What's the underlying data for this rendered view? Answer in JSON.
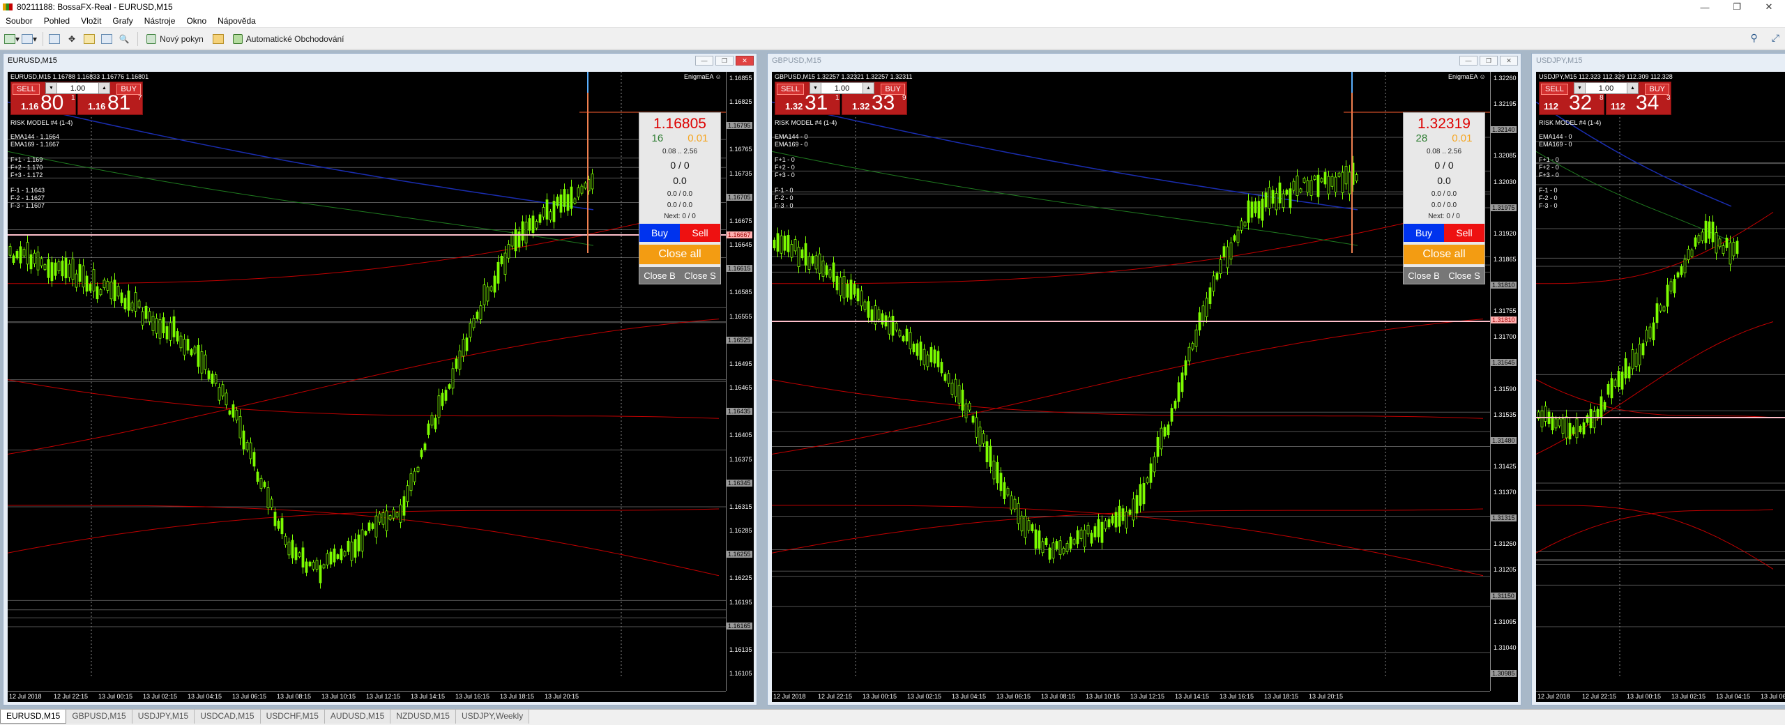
{
  "window": {
    "title": "80211188: BossaFX-Real - EURUSD,M15",
    "min_glyph": "—",
    "max_glyph": "❐",
    "close_glyph": "✕"
  },
  "menu": [
    "Soubor",
    "Pohled",
    "Vložit",
    "Grafy",
    "Nástroje",
    "Okno",
    "Nápověda"
  ],
  "toolbar": {
    "new_order_label": "Nový pokyn",
    "auto_trading_label": "Automatické Obchodování",
    "search_glyph": "⚲",
    "expand_glyph": "⤢"
  },
  "charts": [
    {
      "title": "EURUSD,M15",
      "symbol_line": "EURUSD,M15  1.16788 1.16833 1.16776 1.16801",
      "ea_name": "EnigmaEA ☺",
      "sell_label": "SELL",
      "buy_label": "BUY",
      "lot": "1.00",
      "sell_price": {
        "small": "1.16",
        "big": "80",
        "sup": "1"
      },
      "buy_price": {
        "small": "1.16",
        "big": "81",
        "sup": "7"
      },
      "risk_model": "RISK MODEL #4 (1-4)",
      "info_lines": "EMA144 - 1.1664\nEMA169 - 1.1667\n\nF+1 - 1.169\nF+2 - 1.170\nF+3 - 1.172\n\nF-1 - 1.1643\nF-2 - 1.1627\nF-3 - 1.1607",
      "panel": {
        "price": "1.16805",
        "spread": "16",
        "pip": "0.01",
        "range": "0.08 .. 2.56",
        "ratio": "0 / 0",
        "value": "0.0",
        "triple": "0.0 / 0.0",
        "pair": "0.0 / 0.0",
        "next": "Next: 0 / 0",
        "buy": "Buy",
        "sell": "Sell",
        "close_all": "Close all",
        "close_b": "Close B",
        "close_s": "Close S"
      },
      "prices": [
        "1.16855",
        "1.16825",
        "1.16795",
        "1.16765",
        "1.16735",
        "1.16705",
        "1.16675",
        "1.16645",
        "1.16615",
        "1.16585",
        "1.16555",
        "1.16525",
        "1.16495",
        "1.16465",
        "1.16435",
        "1.16405",
        "1.16375",
        "1.16345",
        "1.16315",
        "1.16285",
        "1.16255",
        "1.16225",
        "1.16195",
        "1.16165",
        "1.16135",
        "1.16105"
      ],
      "current_price": "1.16667",
      "times": [
        "12 Jul 2018",
        "12 Jul 22:15",
        "13 Jul 00:15",
        "13 Jul 02:15",
        "13 Jul 04:15",
        "13 Jul 06:15",
        "13 Jul 08:15",
        "13 Jul 10:15",
        "13 Jul 12:15",
        "13 Jul 14:15",
        "13 Jul 16:15",
        "13 Jul 18:15",
        "13 Jul 20:15"
      ]
    },
    {
      "title": "GBPUSD,M15",
      "symbol_line": "GBPUSD,M15  1.32257 1.32321 1.32257 1.32311",
      "ea_name": "EnigmaEA ☺",
      "sell_label": "SELL",
      "buy_label": "BUY",
      "lot": "1.00",
      "sell_price": {
        "small": "1.32",
        "big": "31",
        "sup": "1"
      },
      "buy_price": {
        "small": "1.32",
        "big": "33",
        "sup": "9"
      },
      "risk_model": "RISK MODEL #4 (1-4)",
      "info_lines": "EMA144 - 0\nEMA169 - 0\n\nF+1 - 0\nF+2 - 0\nF+3 - 0\n\nF-1 - 0\nF-2 - 0\nF-3 - 0",
      "panel": {
        "price": "1.32319",
        "spread": "28",
        "pip": "0.01",
        "range": "0.08 .. 2.56",
        "ratio": "0 / 0",
        "value": "0.0",
        "triple": "0.0 / 0.0",
        "pair": "0.0 / 0.0",
        "next": "Next: 0 / 0",
        "buy": "Buy",
        "sell": "Sell",
        "close_all": "Close all",
        "close_b": "Close B",
        "close_s": "Close S"
      },
      "prices": [
        "1.32260",
        "1.32195",
        "1.32140",
        "1.32085",
        "1.32030",
        "1.31975",
        "1.31920",
        "1.31865",
        "1.31810",
        "1.31755",
        "1.31700",
        "1.31645",
        "1.31590",
        "1.31535",
        "1.31480",
        "1.31425",
        "1.31370",
        "1.31315",
        "1.31260",
        "1.31205",
        "1.31150",
        "1.31095",
        "1.31040",
        "1.30985"
      ],
      "current_price": "1.31810",
      "times": [
        "12 Jul 2018",
        "12 Jul 22:15",
        "13 Jul 00:15",
        "13 Jul 02:15",
        "13 Jul 04:15",
        "13 Jul 06:15",
        "13 Jul 08:15",
        "13 Jul 10:15",
        "13 Jul 12:15",
        "13 Jul 14:15",
        "13 Jul 16:15",
        "13 Jul 18:15",
        "13 Jul 20:15"
      ]
    },
    {
      "title": "USDJPY,M15",
      "symbol_line": "USDJPY,M15  112.323 112.329 112.309 112.328",
      "sell_label": "SELL",
      "buy_label": "BUY",
      "lot": "1.00",
      "sell_price": {
        "small": "112",
        "big": "32",
        "sup": "8"
      },
      "buy_price": {
        "small": "112",
        "big": "34",
        "sup": "3"
      },
      "risk_model": "RISK MODEL #4 (1-4)",
      "info_lines": "EMA144 - 0\nEMA169 - 0\n\nF+1 - 0\nF+2 - 0\nF+3 - 0\n\nF-1 - 0\nF-2 - 0\nF-3 - 0",
      "times": [
        "12 Jul 2018",
        "12 Jul 22:15",
        "13 Jul 00:15",
        "13 Jul 02:15",
        "13 Jul 04:15",
        "13 Jul 06:15"
      ]
    }
  ],
  "tabs": [
    "EURUSD,M15",
    "GBPUSD,M15",
    "USDJPY,M15",
    "USDCAD,M15",
    "USDCHF,M15",
    "AUDUSD,M15",
    "NZDUSD,M15",
    "USDJPY,Weekly"
  ],
  "colors": {
    "candle": "#7CFC00",
    "ema_blue": "#1a2db0",
    "ema_green": "#1f7a1f",
    "fib_red": "#c00000",
    "current_line": "#ffc0cb"
  }
}
